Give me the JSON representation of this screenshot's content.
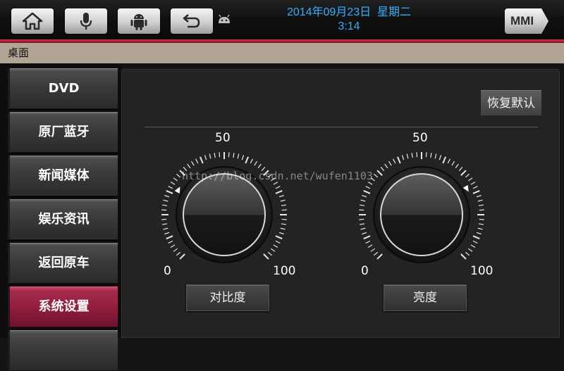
{
  "status_bar": {
    "date": "2014年09月23日",
    "weekday": "星期二",
    "time": "3:14",
    "mmi_label": "MMI",
    "accent_color": "#2fb0ff",
    "icons": [
      "home-icon",
      "microphone-icon",
      "android-icon",
      "back-icon",
      "small-android-icon"
    ]
  },
  "breadcrumb": "桌面",
  "sidebar": {
    "items": [
      {
        "label": "DVD"
      },
      {
        "label": "原厂蓝牙"
      },
      {
        "label": "新闻媒体"
      },
      {
        "label": "娱乐资讯"
      },
      {
        "label": "返回原车"
      },
      {
        "label": "系统设置",
        "active": true
      }
    ],
    "active_color": "#a52a4c"
  },
  "main": {
    "reset_label": "恢复默认",
    "dials": [
      {
        "label": "对比度",
        "min": "0",
        "mid": "50",
        "max": "100",
        "value": 27
      },
      {
        "label": "亮度",
        "min": "0",
        "mid": "50",
        "max": "100",
        "value": 72
      }
    ]
  },
  "watermark": "http://blog.csdn.net/wufen1103"
}
